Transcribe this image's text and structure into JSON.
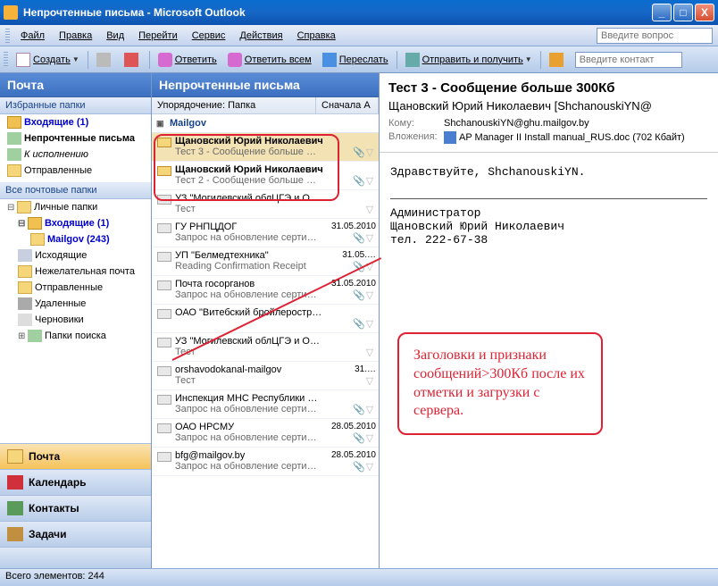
{
  "window": {
    "title": "Непрочтенные письма - Microsoft Outlook"
  },
  "menu": {
    "file": "Файл",
    "edit": "Правка",
    "view": "Вид",
    "goto": "Перейти",
    "tools": "Сервис",
    "actions": "Действия",
    "help": "Справка",
    "ask": "Введите вопрос"
  },
  "toolbar": {
    "create": "Создать",
    "reply": "Ответить",
    "reply_all": "Ответить всем",
    "forward": "Переслать",
    "send_receive": "Отправить и получить",
    "contact_search": "Введите контакт"
  },
  "nav": {
    "header": "Почта",
    "fav_section": "Избранные папки",
    "fav_inbox": "Входящие (1)",
    "fav_unread": "Непрочтенные письма",
    "fav_followup": "К исполнению",
    "fav_sent": "Отправленные",
    "all_section": "Все почтовые папки",
    "personal": "Личные папки",
    "inbox": "Входящие (1)",
    "mailgov": "Mailgov (243)",
    "outbox": "Исходящие",
    "junk": "Нежелательная почта",
    "sent": "Отправленные",
    "deleted": "Удаленные",
    "drafts": "Черновики",
    "search_folders": "Папки поиска",
    "btn_mail": "Почта",
    "btn_cal": "Календарь",
    "btn_contacts": "Контакты",
    "btn_tasks": "Задачи"
  },
  "list": {
    "header": "Непрочтенные письма",
    "sort_label": "Упорядочение: Папка",
    "sort_order": "Сначала А",
    "group": "Mailgov"
  },
  "messages": [
    {
      "from": "Щановский Юрий Николаевич",
      "subject": "Тест 3 - Сообщение больше …",
      "date": "",
      "attach": true,
      "unread": true,
      "selected": true
    },
    {
      "from": "Щановский Юрий Николаевич",
      "subject": "Тест 2 - Сообщение больше …",
      "date": "",
      "attach": true,
      "unread": true
    },
    {
      "from": "УЗ \"Могилевский облЦГЭ и О…",
      "subject": "Тест",
      "date": "",
      "attach": false,
      "unread": false
    },
    {
      "from": "ГУ РНПЦДОГ",
      "subject": "Запрос на обновление серти…",
      "date": "31.05.2010",
      "attach": true,
      "unread": false
    },
    {
      "from": "УП \"Белмедтехника\"",
      "subject": "Reading Confirmation Receipt",
      "date": "31.05.…",
      "attach": true,
      "unread": false
    },
    {
      "from": "Почта госорганов",
      "subject": "Запрос на обновление серти…",
      "date": "31.05.2010",
      "attach": true,
      "unread": false
    },
    {
      "from": "ОАО \"Витебский бройлеростр…",
      "subject": "",
      "date": "",
      "attach": true,
      "unread": false
    },
    {
      "from": "УЗ \"Могилевский облЦГЭ и О…",
      "subject": "Тест",
      "date": "",
      "attach": false,
      "unread": false
    },
    {
      "from": "orshavodokanal-mailgov",
      "subject": "Тест",
      "date": "31.…",
      "attach": false,
      "unread": false
    },
    {
      "from": "Инспекция МНС Республики …",
      "subject": "Запрос на обновление серти…",
      "date": "",
      "attach": true,
      "unread": false
    },
    {
      "from": "ОАО НРСМУ",
      "subject": "Запрос на обновление серти…",
      "date": "28.05.2010",
      "attach": true,
      "unread": false
    },
    {
      "from": "bfg@mailgov.by",
      "subject": "Запрос на обновление серти…",
      "date": "28.05.2010",
      "attach": true,
      "unread": false
    }
  ],
  "reading": {
    "subject": "Тест 3 - Сообщение больше 300Кб",
    "sender": "Щановский Юрий Николаевич [ShchanouskiYN@",
    "to_label": "Кому:",
    "to_value": "ShchanouskiYN@ghu.mailgov.by",
    "attach_label": "Вложения:",
    "attach_value": "AP Manager II Install manual_RUS.doc (702 Кбайт)",
    "body_greeting": "Здравствуйте, ShchanouskiYN.",
    "sig1": "Администратор",
    "sig2": "Щановский Юрий Николаевич",
    "sig3": "тел. 222-67-38"
  },
  "callout": {
    "text": "Заголовки и признаки сообщений>300Кб после их отметки и загрузки с сервера."
  },
  "status": {
    "count": "Всего элементов: 244"
  }
}
